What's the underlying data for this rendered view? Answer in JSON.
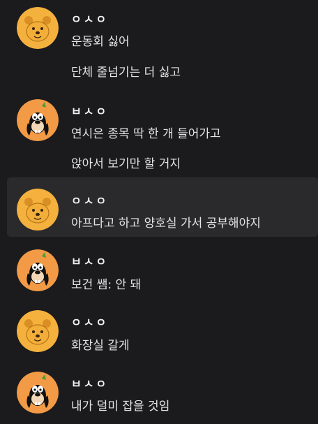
{
  "messages": [
    {
      "author": "ㅇㅅㅇ",
      "avatar": "pooh-avatar",
      "lines": [
        "운동회 싫어",
        "단체 줄넘기는 더 싫고"
      ]
    },
    {
      "author": "ㅂㅅㅇ",
      "avatar": "goofy-avatar",
      "lines": [
        "연시은 종목 딱 한 개 들어가고",
        "앉아서 보기만 할 거지"
      ]
    },
    {
      "author": "ㅇㅅㅇ",
      "avatar": "pooh-avatar",
      "highlighted": true,
      "lines": [
        "아프다고 하고 양호실 가서 공부해야지"
      ]
    },
    {
      "author": "ㅂㅅㅇ",
      "avatar": "goofy-avatar",
      "lines": [
        "보건 쌤: 안 돼"
      ]
    },
    {
      "author": "ㅇㅅㅇ",
      "avatar": "pooh-avatar",
      "lines": [
        "화장실 갈게"
      ]
    },
    {
      "author": "ㅂㅅㅇ",
      "avatar": "goofy-avatar",
      "lines": [
        "내가 덜미 잡을 것임"
      ]
    }
  ],
  "colors": {
    "background": "#1b1b1d",
    "highlight": "#2a2a2c",
    "pooh_yellow": "#f5b13d",
    "goofy_orange": "#f29a45"
  }
}
